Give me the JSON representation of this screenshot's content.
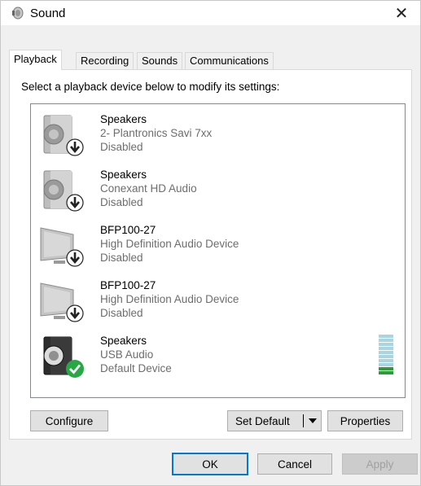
{
  "window": {
    "title": "Sound",
    "close_glyph": "✕"
  },
  "tabs": [
    {
      "label": "Playback",
      "active": true
    },
    {
      "label": "Recording",
      "active": false
    },
    {
      "label": "Sounds",
      "active": false
    },
    {
      "label": "Communications",
      "active": false
    }
  ],
  "instruction": "Select a playback device below to modify its settings:",
  "devices": [
    {
      "name": "Speakers",
      "description": "2- Plantronics Savi 7xx",
      "status": "Disabled",
      "icon": "speaker-disabled-icon"
    },
    {
      "name": "Speakers",
      "description": "Conexant HD Audio",
      "status": "Disabled",
      "icon": "speaker-disabled-icon"
    },
    {
      "name": "BFP100-27",
      "description": "High Definition Audio Device",
      "status": "Disabled",
      "icon": "monitor-disabled-icon"
    },
    {
      "name": "BFP100-27",
      "description": "High Definition Audio Device",
      "status": "Disabled",
      "icon": "monitor-disabled-icon"
    },
    {
      "name": "Speakers",
      "description": "USB Audio",
      "status": "Default Device",
      "icon": "speaker-default-icon"
    }
  ],
  "level_meter": {
    "bars": 10,
    "lit": 2,
    "lit_color": "#2e9a3a",
    "unlit_color": "#a9d5e0"
  },
  "buttons": {
    "configure": "Configure",
    "set_default": "Set Default",
    "properties": "Properties",
    "ok": "OK",
    "cancel": "Cancel",
    "apply": "Apply"
  },
  "colors": {
    "accent": "#0078d7",
    "status_ok": "#28a745",
    "disabled_badge": "#222222"
  }
}
